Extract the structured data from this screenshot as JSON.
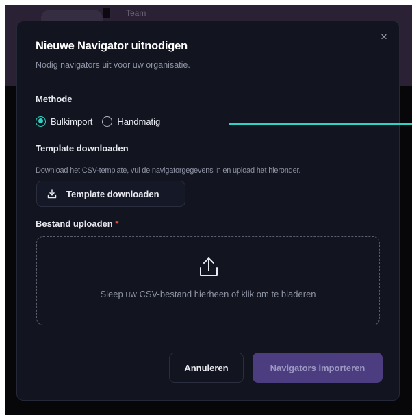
{
  "background": {
    "team_label": "Team"
  },
  "modal": {
    "title": "Nieuwe Navigator uitnodigen",
    "subtitle": "Nodig navigators uit voor uw organisatie.",
    "close_glyph": "×",
    "method": {
      "label": "Methode",
      "options": [
        {
          "label": "Bulkimport",
          "selected": true
        },
        {
          "label": "Handmatig",
          "selected": false
        }
      ]
    },
    "template": {
      "label": "Template downloaden",
      "helper": "Download het CSV-template, vul de navigatorgegevens in en upload het hieronder.",
      "button_label": "Template downloaden",
      "button_icon": "download-icon"
    },
    "upload": {
      "label": "Bestand uploaden",
      "required_mark": "*",
      "icon": "upload-icon",
      "dropzone_text": "Sleep uw CSV-bestand hierheen of klik om te bladeren"
    },
    "footer": {
      "cancel_label": "Annuleren",
      "import_label": "Navigators importeren"
    }
  },
  "colors": {
    "accent": "#2ed3c3",
    "primary_button": "#4b3d80",
    "required": "#e0533f",
    "modal_bg": "#121420",
    "backdrop_top": "#2b2135"
  }
}
